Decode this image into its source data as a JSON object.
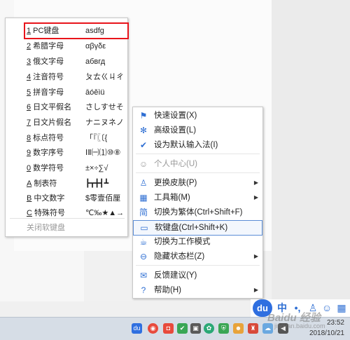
{
  "soft_keyboard_menu": {
    "items": [
      {
        "num": "1",
        "label": "PC键盘",
        "sample": "asdfg"
      },
      {
        "num": "2",
        "label": "希腊字母",
        "sample": "αβγδε"
      },
      {
        "num": "3",
        "label": "俄文字母",
        "sample": "абвгд"
      },
      {
        "num": "4",
        "label": "注音符号",
        "sample": "ㄆㄊㄍㄐㄔ"
      },
      {
        "num": "5",
        "label": "拼音字母",
        "sample": "āóěìü"
      },
      {
        "num": "6",
        "label": "日文平假名",
        "sample": "さしすせそ"
      },
      {
        "num": "7",
        "label": "日文片假名",
        "sample": "ナニヌネノ"
      },
      {
        "num": "8",
        "label": "标点符号",
        "sample": "「『〖〔{"
      },
      {
        "num": "9",
        "label": "数字序号",
        "sample": "ⅠⅡ㈠⑴⑩⑧"
      },
      {
        "num": "0",
        "label": "数学符号",
        "sample": "±×÷∑√"
      },
      {
        "num": "A",
        "label": "制表符",
        "sample": "┣┳╋┫┻"
      },
      {
        "num": "B",
        "label": "中文数字",
        "sample": "$零壹佰厘"
      },
      {
        "num": "C",
        "label": "特殊符号",
        "sample": "℃‰★▲→"
      }
    ],
    "close_label": "关闭软键盘"
  },
  "ime_menu": {
    "items": [
      {
        "icon": "flag-icon",
        "glyph": "⚑",
        "label": "快速设置(X)",
        "submenu": false
      },
      {
        "icon": "gear-icon",
        "glyph": "✻",
        "label": "高级设置(L)",
        "submenu": false
      },
      {
        "icon": "check-circle-icon",
        "glyph": "✔",
        "label": "设为默认输入法(I)",
        "submenu": false
      },
      {
        "icon": "user-icon",
        "glyph": "☺",
        "label": "个人中心(U)",
        "submenu": false,
        "disabled": true
      },
      {
        "icon": "shirt-icon",
        "glyph": "♙",
        "label": "更换皮肤(P)",
        "submenu": true
      },
      {
        "icon": "grid-icon",
        "glyph": "▦",
        "label": "工具箱(M)",
        "submenu": true
      },
      {
        "icon": "traditional-icon",
        "glyph": "简",
        "label": "切换为繁体(Ctrl+Shift+F)",
        "submenu": false
      },
      {
        "icon": "keyboard-icon",
        "glyph": "▭",
        "label": "软键盘(Ctrl+Shift+K)",
        "submenu": false,
        "active": true
      },
      {
        "icon": "cup-icon",
        "glyph": "☕",
        "label": "切换为工作模式",
        "submenu": false
      },
      {
        "icon": "hide-icon",
        "glyph": "⊖",
        "label": "隐藏状态栏(Z)",
        "submenu": true
      },
      {
        "icon": "feedback-icon",
        "glyph": "✉",
        "label": "反馈建议(Y)",
        "submenu": false
      },
      {
        "icon": "help-icon",
        "glyph": "?",
        "label": "帮助(H)",
        "submenu": true
      }
    ]
  },
  "ime_toolbar": {
    "logo": "du",
    "mode": "中",
    "punct": "•,",
    "shirt": "♙",
    "user": "☺",
    "grid": "▦"
  },
  "taskbar": {
    "time": "23:52",
    "date": "2018/10/21"
  },
  "watermark": {
    "brand": "Baidu 经验",
    "site": "jingyan.baidu.com"
  },
  "colors": {
    "highlight_border": "#e8141b",
    "accent": "#2f6fd3",
    "active_border": "#5b8dd6"
  }
}
